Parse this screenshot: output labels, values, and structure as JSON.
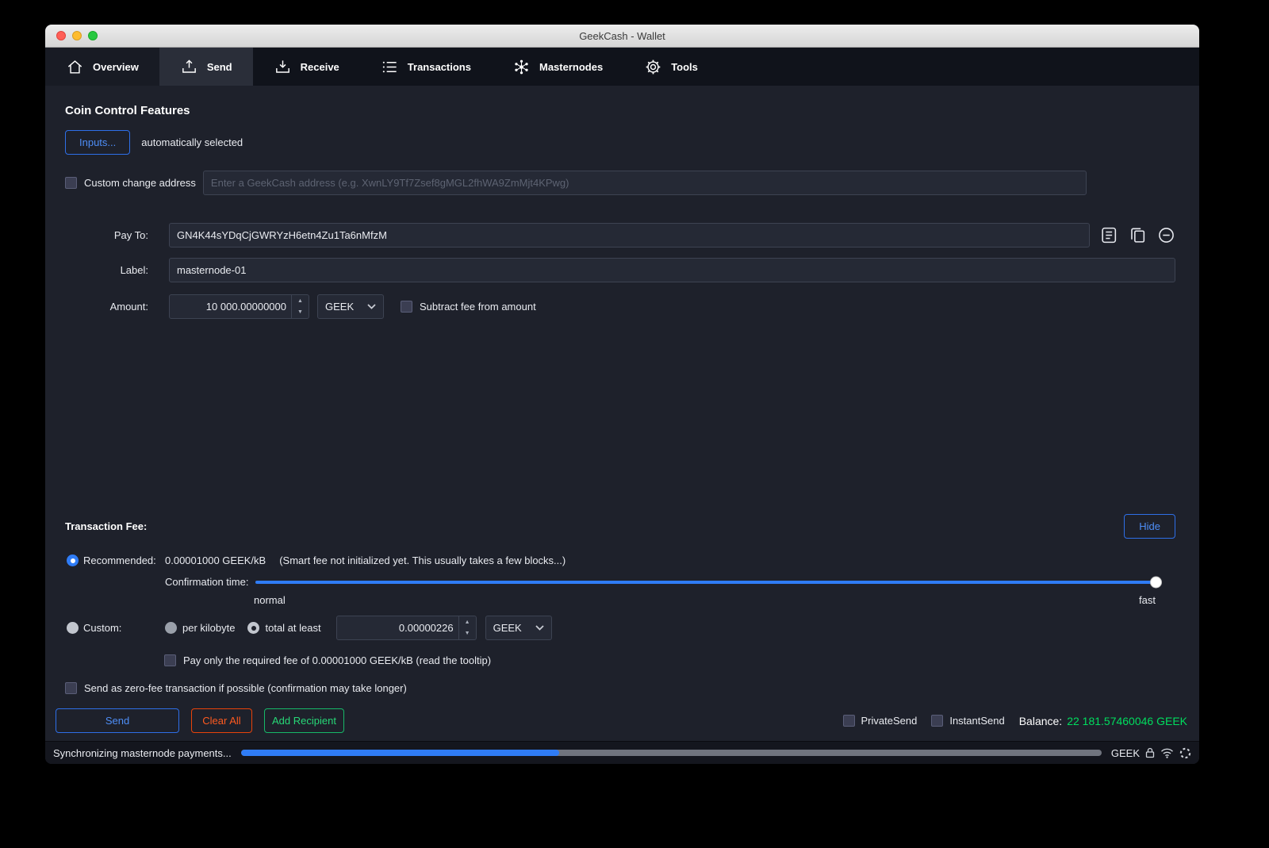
{
  "window": {
    "title": "GeekCash - Wallet"
  },
  "nav": {
    "tabs": [
      {
        "label": "Overview",
        "icon": "home-icon",
        "active": false
      },
      {
        "label": "Send",
        "icon": "send-icon",
        "active": true
      },
      {
        "label": "Receive",
        "icon": "receive-icon",
        "active": false
      },
      {
        "label": "Transactions",
        "icon": "transactions-icon",
        "active": false
      },
      {
        "label": "Masternodes",
        "icon": "masternodes-icon",
        "active": false
      },
      {
        "label": "Tools",
        "icon": "tools-icon",
        "active": false
      }
    ]
  },
  "coin_control": {
    "heading": "Coin Control Features",
    "inputs_button": "Inputs...",
    "auto_selected": "automatically selected",
    "custom_change_label": "Custom change address",
    "change_placeholder": "Enter a GeekCash address (e.g. XwnLY9Tf7Zsef8gMGL2fhWA9ZmMjt4KPwg)"
  },
  "recipient": {
    "pay_to_label": "Pay To:",
    "pay_to_value": "GN4K44sYDqCjGWRYzH6etn4Zu1Ta6nMfzM",
    "label_label": "Label:",
    "label_value": "masternode-01",
    "amount_label": "Amount:",
    "amount_value": "10 000.00000000",
    "currency": "GEEK",
    "subtract_fee_label": "Subtract fee from amount"
  },
  "fee": {
    "heading": "Transaction Fee:",
    "hide_button": "Hide",
    "recommended_label": "Recommended:",
    "recommended_value": "0.00001000 GEEK/kB",
    "smart_fee_note": "(Smart fee not initialized yet. This usually takes a few blocks...)",
    "confirmation_label": "Confirmation time:",
    "slider_left": "normal",
    "slider_right": "fast",
    "slider_pct": 100,
    "custom_label": "Custom:",
    "per_kilobyte_label": "per kilobyte",
    "total_at_least_label": "total at least",
    "custom_value": "0.00000226",
    "custom_currency": "GEEK",
    "pay_required_label": "Pay only the required fee of 0.00001000 GEEK/kB (read the tooltip)",
    "zero_fee_label": "Send as zero-fee transaction if possible (confirmation may take longer)"
  },
  "actions": {
    "send": "Send",
    "clear_all": "Clear All",
    "add_recipient": "Add Recipient",
    "privatesend": "PrivateSend",
    "instantsend": "InstantSend",
    "balance_label": "Balance:",
    "balance_value": "22 181.57460046 GEEK"
  },
  "statusbar": {
    "message": "Synchronizing masternode payments...",
    "progress_pct": 37,
    "network": "GEEK",
    "icons": [
      "hd-wallet-icon",
      "connections-icon",
      "sync-spinner-icon"
    ]
  },
  "colors": {
    "accent_blue": "#2f7cf6",
    "orange": "#ff5a1f",
    "green": "#27d877",
    "balance_green": "#00dd5e"
  }
}
